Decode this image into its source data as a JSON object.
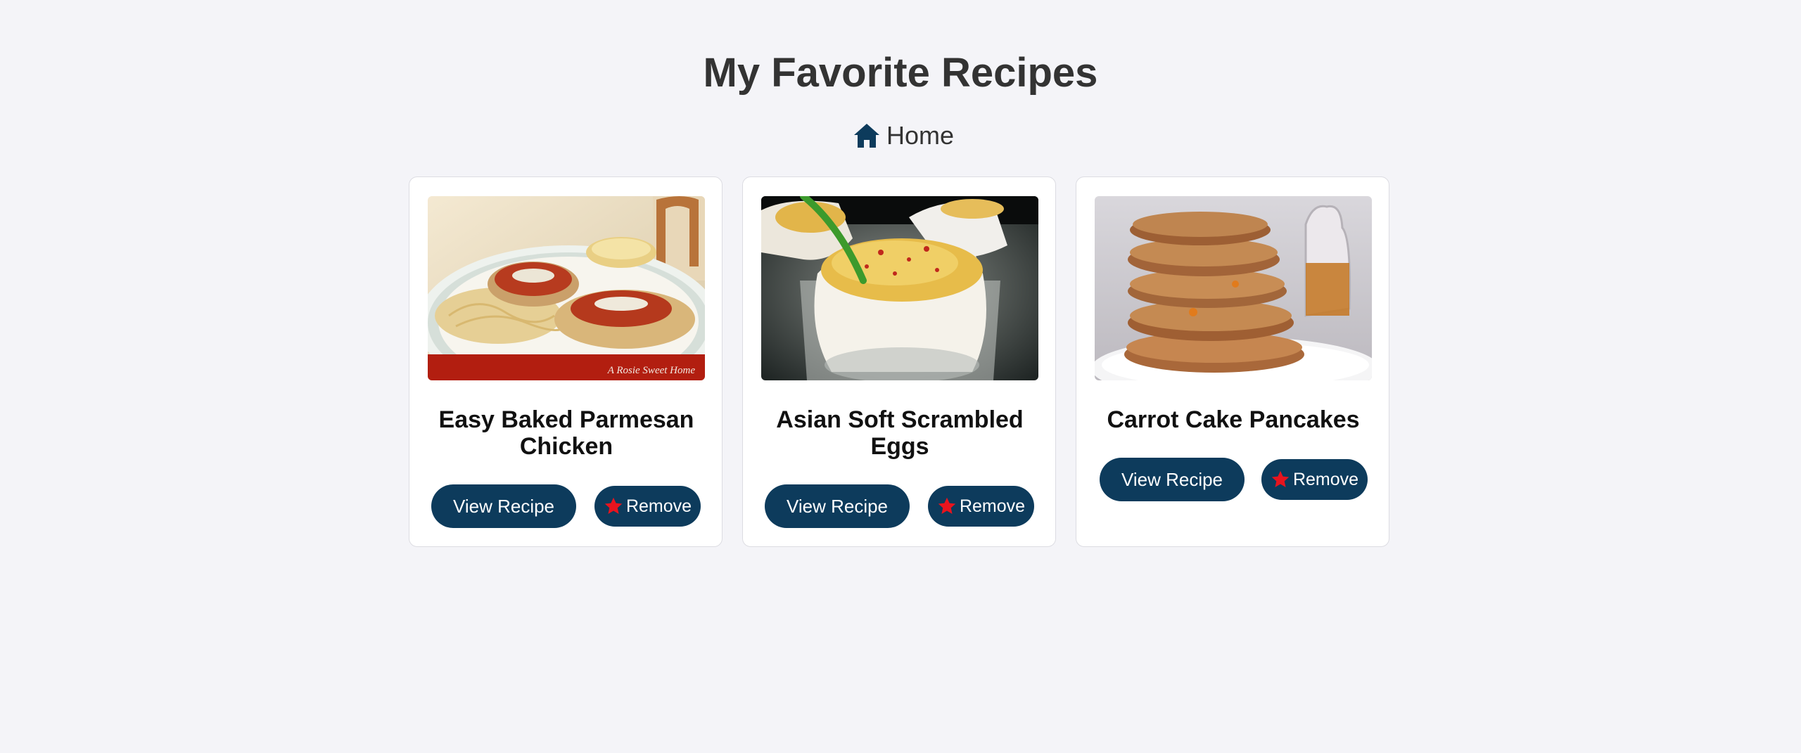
{
  "page": {
    "title": "My Favorite Recipes"
  },
  "nav": {
    "home_label": "Home",
    "home_icon": "home-icon"
  },
  "colors": {
    "background": "#f4f4f8",
    "button": "#0d3b5c",
    "star": "#e8141e"
  },
  "recipes": [
    {
      "title": "Easy Baked Parmesan Chicken",
      "view_label": "View Recipe",
      "remove_label": "Remove",
      "image_alt": "Easy Baked Parmesan Chicken",
      "watermark": "A Rosie Sweet Home"
    },
    {
      "title": "Asian Soft Scrambled Eggs",
      "view_label": "View Recipe",
      "remove_label": "Remove",
      "image_alt": "Asian Soft Scrambled Eggs"
    },
    {
      "title": "Carrot Cake Pancakes",
      "view_label": "View Recipe",
      "remove_label": "Remove",
      "image_alt": "Carrot Cake Pancakes"
    }
  ]
}
